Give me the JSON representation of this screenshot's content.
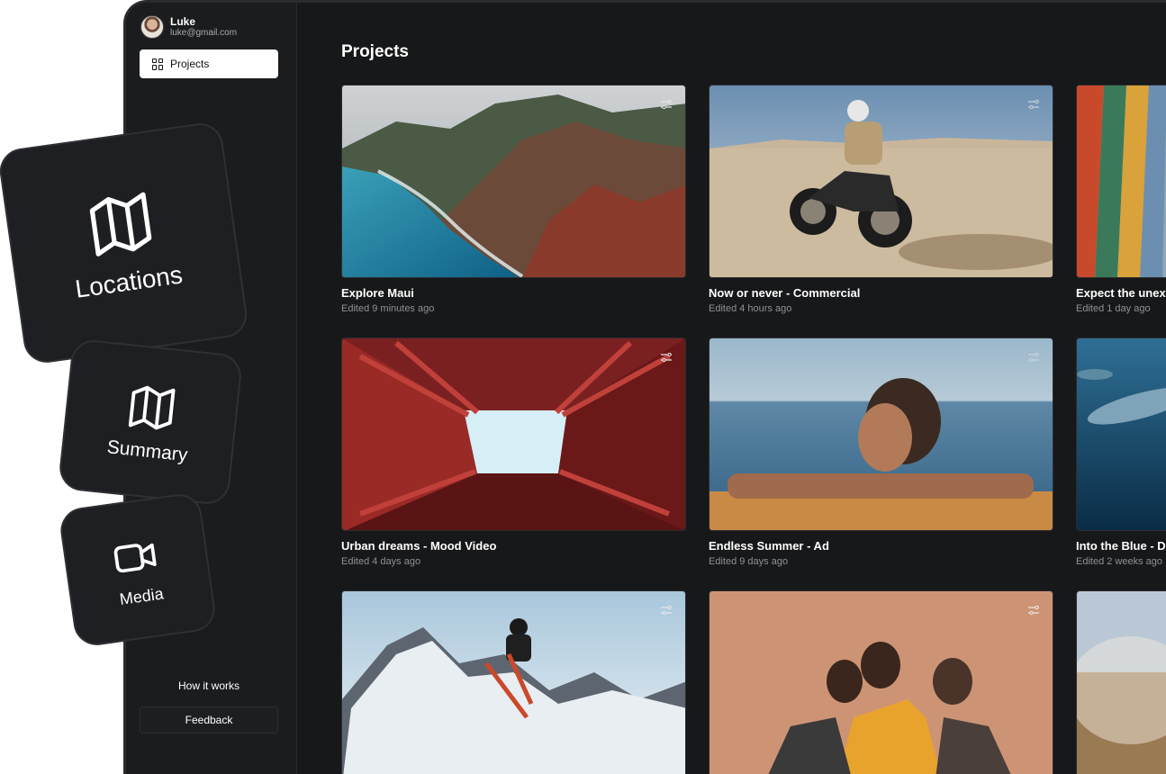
{
  "user": {
    "name": "Luke",
    "email": "luke@gmail.com"
  },
  "nav": {
    "projects_label": "Projects"
  },
  "footer": {
    "how_label": "How it works",
    "feedback_label": "Feedback"
  },
  "main": {
    "title": "Projects"
  },
  "projects": [
    {
      "title": "Explore Maui",
      "edited": "Edited 9 minutes ago"
    },
    {
      "title": "Now or never - Commercial",
      "edited": "Edited 4 hours ago"
    },
    {
      "title": "Expect the unex",
      "edited": "Edited 1 day ago"
    },
    {
      "title": "Urban dreams - Mood Video",
      "edited": "Edited 4 days ago"
    },
    {
      "title": "Endless Summer - Ad",
      "edited": "Edited 9 days ago"
    },
    {
      "title": "Into the Blue - D",
      "edited": "Edited 2 weeks ago"
    },
    {
      "title": "",
      "edited": ""
    },
    {
      "title": "",
      "edited": ""
    },
    {
      "title": "",
      "edited": ""
    }
  ],
  "tiles": {
    "locations": "Locations",
    "summary": "Summary",
    "media": "Media"
  },
  "icons": {
    "tile_locations": "map-icon",
    "tile_summary": "map-icon",
    "tile_media": "video-camera-icon",
    "settings": "sliders-icon",
    "nav": "grid-icon"
  }
}
